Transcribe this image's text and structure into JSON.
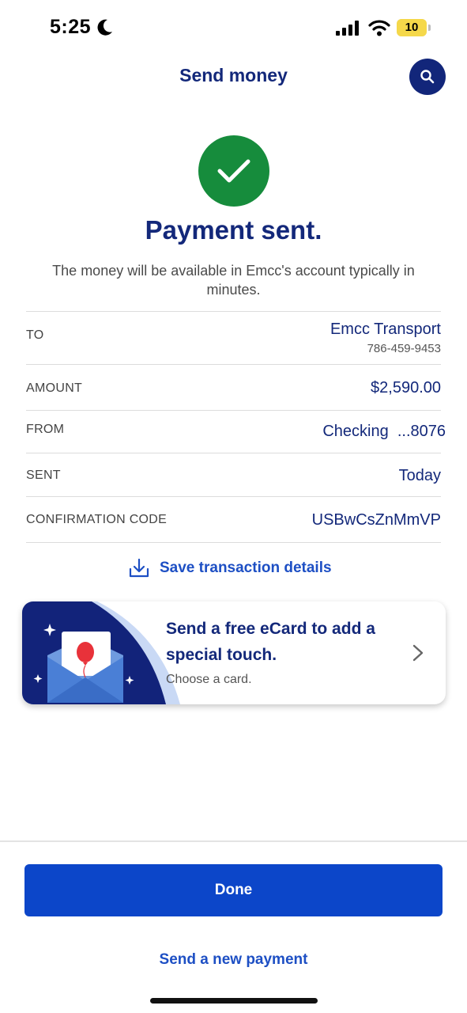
{
  "status_bar": {
    "time": "5:25",
    "battery_level": "10",
    "icons": [
      "moon-icon",
      "signal-icon",
      "wifi-icon",
      "battery-icon"
    ]
  },
  "header": {
    "title": "Send money",
    "search_icon": "search-icon"
  },
  "success": {
    "icon": "checkmark-icon",
    "title": "Payment sent.",
    "message": "The money will be available in Emcc's account typically in minutes."
  },
  "details": {
    "to": {
      "label": "TO",
      "name": "Emcc Transport",
      "phone": "786-459-9453"
    },
    "amount": {
      "label": "AMOUNT",
      "value": "$2,590.00"
    },
    "from": {
      "label": "FROM",
      "value": "Checking  ...8076"
    },
    "sent": {
      "label": "SENT",
      "value": "Today"
    },
    "confirmation": {
      "label": "CONFIRMATION CODE",
      "value": "USBwCsZnMmVP"
    }
  },
  "save_link": {
    "label": "Save transaction details",
    "icon": "download-icon"
  },
  "ecard": {
    "title": "Send a free eCard to add a special touch.",
    "subtitle": "Choose a card.",
    "icon": "envelope-balloon-illustration"
  },
  "actions": {
    "done_label": "Done",
    "new_payment_label": "Send a new payment"
  },
  "colors": {
    "brand_navy": "#13287a",
    "primary_blue": "#0c46c9",
    "link_blue": "#1d4fc4",
    "success_green": "#168c3c"
  }
}
